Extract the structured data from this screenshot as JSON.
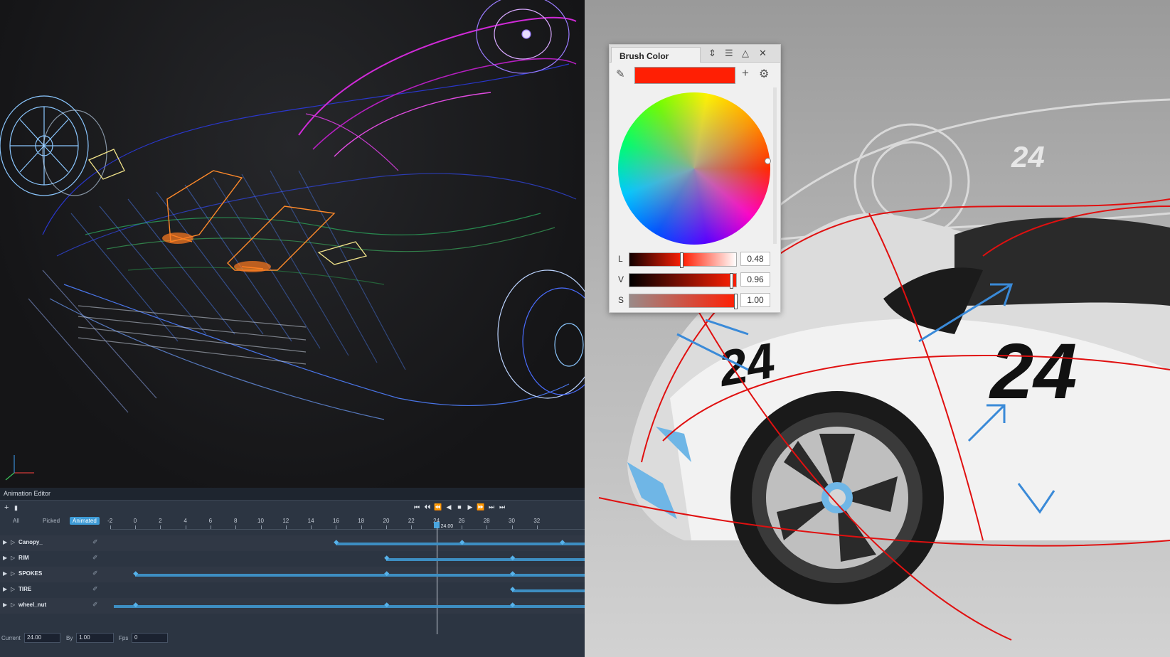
{
  "animation_editor": {
    "title": "Animation Editor",
    "add_icon": "+",
    "delete_icon": "🗑",
    "filters": [
      "All",
      "Picked",
      "Animated"
    ],
    "active_filter": "Animated",
    "transport": [
      "⏮",
      "⏴⏴",
      "⏪",
      "◀",
      "■",
      "▶",
      "⏩",
      "⏭",
      "⏭"
    ],
    "ruler_ticks": [
      "-2",
      "0",
      "2",
      "4",
      "6",
      "8",
      "10",
      "12",
      "14",
      "16",
      "18",
      "20",
      "22",
      "24",
      "26",
      "28",
      "30",
      "32"
    ],
    "playhead_value": 24,
    "playhead_label": "24.00",
    "tracks": [
      {
        "name": "Canopy_",
        "start": 16,
        "keys": [
          16,
          26,
          34
        ]
      },
      {
        "name": "RIM",
        "start": 20,
        "keys": [
          20,
          30
        ]
      },
      {
        "name": "SPOKES",
        "start": 0,
        "keys": [
          0,
          20,
          30
        ]
      },
      {
        "name": "TIRE",
        "start": 30,
        "keys": [
          30
        ]
      },
      {
        "name": "wheel_nut",
        "start": -10,
        "keys": [
          -10,
          0,
          20,
          30
        ]
      }
    ],
    "footer": {
      "current_label": "Current",
      "current_value": "24.00",
      "by_label": "By",
      "by_value": "1.00",
      "fps_label": "Fps",
      "fps_value": "0"
    }
  },
  "brush_color": {
    "title": "Brush Color",
    "color": "#ff1f04",
    "icons": [
      "pin-icon",
      "menu-icon",
      "collapse-icon",
      "close-icon",
      "eyedropper-icon",
      "add-icon",
      "settings-icon"
    ],
    "sliders": [
      {
        "label": "L",
        "value": "0.48",
        "fraction": 0.48,
        "gradient": "linear-gradient(90deg,#120000,#ff1f04,#ffffff)"
      },
      {
        "label": "V",
        "value": "0.96",
        "fraction": 0.96,
        "gradient": "linear-gradient(90deg,#000000,#ff1f04)"
      },
      {
        "label": "S",
        "value": "1.00",
        "fraction": 1.0,
        "gradient": "linear-gradient(90deg,#9a8a88,#ff1f04)"
      }
    ]
  },
  "car_number": "24"
}
